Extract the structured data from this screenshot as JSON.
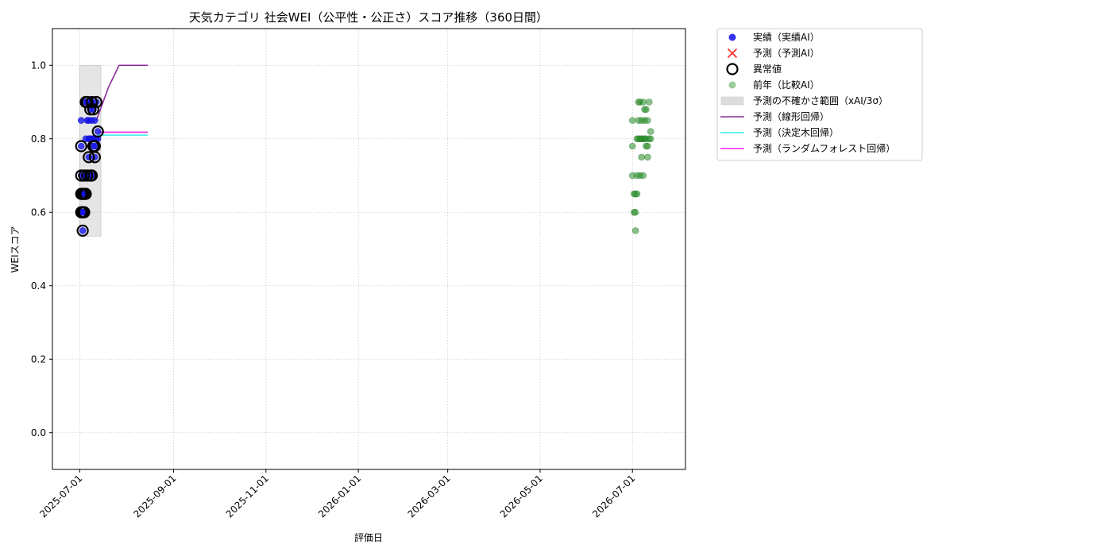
{
  "chart_data": {
    "type": "scatter",
    "title": "天気カテゴリ 社会WEI（公平性・公正さ）スコア推移（360日間）",
    "xlabel": "評価日",
    "ylabel": "WEIスコア",
    "x_ticks": [
      "2025-07-01",
      "2025-09-01",
      "2025-11-01",
      "2026-01-01",
      "2026-03-01",
      "2026-05-01",
      "2026-07-01"
    ],
    "y_ticks": [
      "0.0",
      "0.2",
      "0.4",
      "0.6",
      "0.8",
      "1.0"
    ],
    "xlim": [
      "2025-06-13",
      "2026-08-05"
    ],
    "ylim": [
      -0.1,
      1.1
    ],
    "grid": true,
    "legend_position": "outside-right",
    "legend": [
      {
        "label": "実績（実績AI）",
        "kind": "dot",
        "color": "#0000ee"
      },
      {
        "label": "予測（予測AI）",
        "kind": "x",
        "color": "#ff3333"
      },
      {
        "label": "異常値",
        "kind": "ring",
        "color": "#000000"
      },
      {
        "label": "前年（比較AI）",
        "kind": "dot",
        "color": "#4aa04a"
      },
      {
        "label": "予測の不確かさ範囲（xAI/3σ）",
        "kind": "band",
        "color": "#dddddd"
      },
      {
        "label": "予測（線形回帰）",
        "kind": "line",
        "color": "#8b2a9b"
      },
      {
        "label": "予測（決定木回帰）",
        "kind": "line",
        "color": "#33eeee"
      },
      {
        "label": "予測（ランダムフォレスト回帰）",
        "kind": "line",
        "color": "#ee22ee"
      }
    ],
    "actual": [
      {
        "x": "2025-07-02",
        "y": 0.85
      },
      {
        "x": "2025-07-02",
        "y": 0.78
      },
      {
        "x": "2025-07-02",
        "y": 0.7
      },
      {
        "x": "2025-07-02",
        "y": 0.65
      },
      {
        "x": "2025-07-02",
        "y": 0.6
      },
      {
        "x": "2025-07-03",
        "y": 0.65
      },
      {
        "x": "2025-07-03",
        "y": 0.6
      },
      {
        "x": "2025-07-03",
        "y": 0.55
      },
      {
        "x": "2025-07-04",
        "y": 0.7
      },
      {
        "x": "2025-07-04",
        "y": 0.65
      },
      {
        "x": "2025-07-04",
        "y": 0.6
      },
      {
        "x": "2025-07-05",
        "y": 0.65
      },
      {
        "x": "2025-07-05",
        "y": 0.8
      },
      {
        "x": "2025-07-05",
        "y": 0.9
      },
      {
        "x": "2025-07-06",
        "y": 0.85
      },
      {
        "x": "2025-07-06",
        "y": 0.7
      },
      {
        "x": "2025-07-06",
        "y": 0.9
      },
      {
        "x": "2025-07-07",
        "y": 0.8
      },
      {
        "x": "2025-07-07",
        "y": 0.75
      },
      {
        "x": "2025-07-07",
        "y": 0.85
      },
      {
        "x": "2025-07-08",
        "y": 0.8
      },
      {
        "x": "2025-07-08",
        "y": 0.7
      },
      {
        "x": "2025-07-08",
        "y": 0.88
      },
      {
        "x": "2025-07-09",
        "y": 0.85
      },
      {
        "x": "2025-07-09",
        "y": 0.8
      },
      {
        "x": "2025-07-09",
        "y": 0.9
      },
      {
        "x": "2025-07-09",
        "y": 0.7
      },
      {
        "x": "2025-07-10",
        "y": 0.88
      },
      {
        "x": "2025-07-10",
        "y": 0.78
      },
      {
        "x": "2025-07-10",
        "y": 0.8
      },
      {
        "x": "2025-07-11",
        "y": 0.85
      },
      {
        "x": "2025-07-11",
        "y": 0.75
      },
      {
        "x": "2025-07-11",
        "y": 0.78
      },
      {
        "x": "2025-07-12",
        "y": 0.8
      },
      {
        "x": "2025-07-12",
        "y": 0.9
      },
      {
        "x": "2025-07-13",
        "y": 0.82
      },
      {
        "x": "2025-07-13",
        "y": 0.8
      }
    ],
    "anomalies": [
      {
        "x": "2025-07-02",
        "y": 0.78
      },
      {
        "x": "2025-07-02",
        "y": 0.7
      },
      {
        "x": "2025-07-02",
        "y": 0.65
      },
      {
        "x": "2025-07-02",
        "y": 0.6
      },
      {
        "x": "2025-07-03",
        "y": 0.65
      },
      {
        "x": "2025-07-03",
        "y": 0.6
      },
      {
        "x": "2025-07-03",
        "y": 0.55
      },
      {
        "x": "2025-07-04",
        "y": 0.7
      },
      {
        "x": "2025-07-04",
        "y": 0.65
      },
      {
        "x": "2025-07-04",
        "y": 0.6
      },
      {
        "x": "2025-07-05",
        "y": 0.65
      },
      {
        "x": "2025-07-05",
        "y": 0.9
      },
      {
        "x": "2025-07-06",
        "y": 0.7
      },
      {
        "x": "2025-07-06",
        "y": 0.9
      },
      {
        "x": "2025-07-07",
        "y": 0.75
      },
      {
        "x": "2025-07-08",
        "y": 0.7
      },
      {
        "x": "2025-07-08",
        "y": 0.88
      },
      {
        "x": "2025-07-09",
        "y": 0.9
      },
      {
        "x": "2025-07-09",
        "y": 0.7
      },
      {
        "x": "2025-07-10",
        "y": 0.88
      },
      {
        "x": "2025-07-10",
        "y": 0.78
      },
      {
        "x": "2025-07-11",
        "y": 0.75
      },
      {
        "x": "2025-07-11",
        "y": 0.78
      },
      {
        "x": "2025-07-12",
        "y": 0.9
      },
      {
        "x": "2025-07-13",
        "y": 0.82
      }
    ],
    "previous_year": [
      {
        "x": "2026-07-01",
        "y": 0.85
      },
      {
        "x": "2026-07-01",
        "y": 0.78
      },
      {
        "x": "2026-07-01",
        "y": 0.7
      },
      {
        "x": "2026-07-02",
        "y": 0.65
      },
      {
        "x": "2026-07-02",
        "y": 0.6
      },
      {
        "x": "2026-07-03",
        "y": 0.65
      },
      {
        "x": "2026-07-03",
        "y": 0.55
      },
      {
        "x": "2026-07-03",
        "y": 0.6
      },
      {
        "x": "2026-07-04",
        "y": 0.65
      },
      {
        "x": "2026-07-04",
        "y": 0.8
      },
      {
        "x": "2026-07-04",
        "y": 0.7
      },
      {
        "x": "2026-07-05",
        "y": 0.8
      },
      {
        "x": "2026-07-05",
        "y": 0.9
      },
      {
        "x": "2026-07-05",
        "y": 0.85
      },
      {
        "x": "2026-07-06",
        "y": 0.9
      },
      {
        "x": "2026-07-06",
        "y": 0.8
      },
      {
        "x": "2026-07-06",
        "y": 0.7
      },
      {
        "x": "2026-07-07",
        "y": 0.85
      },
      {
        "x": "2026-07-07",
        "y": 0.8
      },
      {
        "x": "2026-07-07",
        "y": 0.75
      },
      {
        "x": "2026-07-08",
        "y": 0.8
      },
      {
        "x": "2026-07-08",
        "y": 0.9
      },
      {
        "x": "2026-07-08",
        "y": 0.7
      },
      {
        "x": "2026-07-09",
        "y": 0.85
      },
      {
        "x": "2026-07-09",
        "y": 0.8
      },
      {
        "x": "2026-07-09",
        "y": 0.88
      },
      {
        "x": "2026-07-10",
        "y": 0.88
      },
      {
        "x": "2026-07-10",
        "y": 0.8
      },
      {
        "x": "2026-07-10",
        "y": 0.78
      },
      {
        "x": "2026-07-11",
        "y": 0.85
      },
      {
        "x": "2026-07-11",
        "y": 0.75
      },
      {
        "x": "2026-07-11",
        "y": 0.78
      },
      {
        "x": "2026-07-12",
        "y": 0.8
      },
      {
        "x": "2026-07-12",
        "y": 0.9
      },
      {
        "x": "2026-07-13",
        "y": 0.82
      },
      {
        "x": "2026-07-13",
        "y": 0.8
      }
    ],
    "uncertainty_band": {
      "x_start": "2025-07-01",
      "x_end": "2025-07-15",
      "y_low": 0.535,
      "y_high": 1.0
    },
    "forecast_lines": [
      {
        "label": "予測（線形回帰）",
        "color": "#8b2a9b",
        "points": [
          {
            "x": "2025-07-12",
            "y": 0.85
          },
          {
            "x": "2025-07-20",
            "y": 0.94
          },
          {
            "x": "2025-07-27",
            "y": 1.0
          },
          {
            "x": "2025-08-15",
            "y": 1.0
          }
        ]
      },
      {
        "label": "予測（決定木回帰）",
        "color": "#33eeee",
        "points": [
          {
            "x": "2025-07-13",
            "y": 0.81
          },
          {
            "x": "2025-08-15",
            "y": 0.81
          }
        ]
      },
      {
        "label": "予測（ランダムフォレスト回帰）",
        "color": "#ee22ee",
        "points": [
          {
            "x": "2025-07-13",
            "y": 0.818
          },
          {
            "x": "2025-08-15",
            "y": 0.818
          }
        ]
      }
    ]
  }
}
